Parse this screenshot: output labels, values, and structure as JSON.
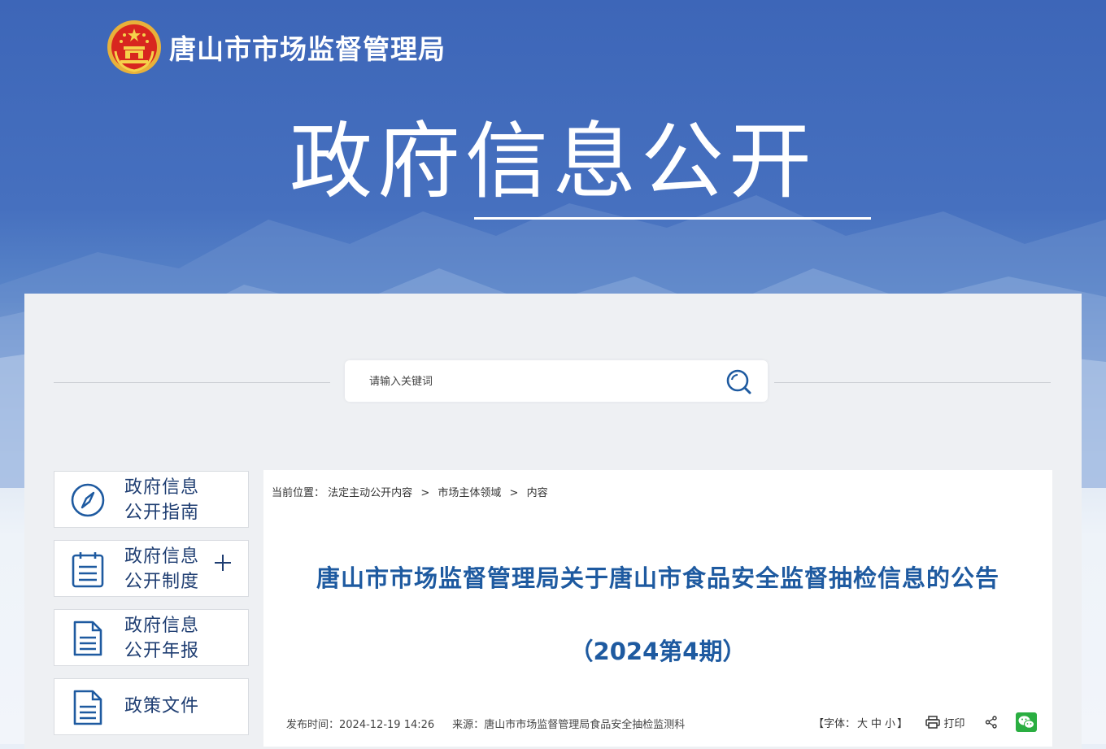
{
  "header": {
    "site_name": "唐山市市场监督管理局",
    "hero_title": "政府信息公开"
  },
  "search": {
    "placeholder": "请输入关键词",
    "button_icon": "search-icon"
  },
  "sidebar": {
    "items": [
      {
        "label": "政府信息公开指南",
        "icon": "compass-icon"
      },
      {
        "label": "政府信息公开制度",
        "icon": "clipboard-icon",
        "expand_icon": "plus-icon"
      },
      {
        "label": "政府信息公开年报",
        "icon": "document-icon"
      },
      {
        "label": "政策文件",
        "icon": "document-icon"
      }
    ]
  },
  "breadcrumb": {
    "prefix": "当前位置：",
    "items": [
      "法定主动公开内容",
      "市场主体领域",
      "内容"
    ],
    "separator": ">"
  },
  "article": {
    "title": "唐山市市场监督管理局关于唐山市食品安全监督抽检信息的公告",
    "subtitle": "（2024第4期）",
    "publish_label": "发布时间：",
    "publish_time": "2024-12-19 14:26",
    "source_label": "来源：",
    "source": "唐山市市场监督管理局食品安全抽检监测科"
  },
  "tools": {
    "font_prefix": "【字体：",
    "font_large": "大",
    "font_medium": "中",
    "font_small": "小",
    "font_suffix": "】",
    "print_label": "打印",
    "share_icon": "share-icon",
    "wechat_icon": "wechat-icon"
  },
  "colors": {
    "banner_blue": "#3d66b8",
    "title_blue": "#1e5aa0",
    "sidebar_text": "#1f3e72",
    "wechat_green": "#2aae41"
  }
}
